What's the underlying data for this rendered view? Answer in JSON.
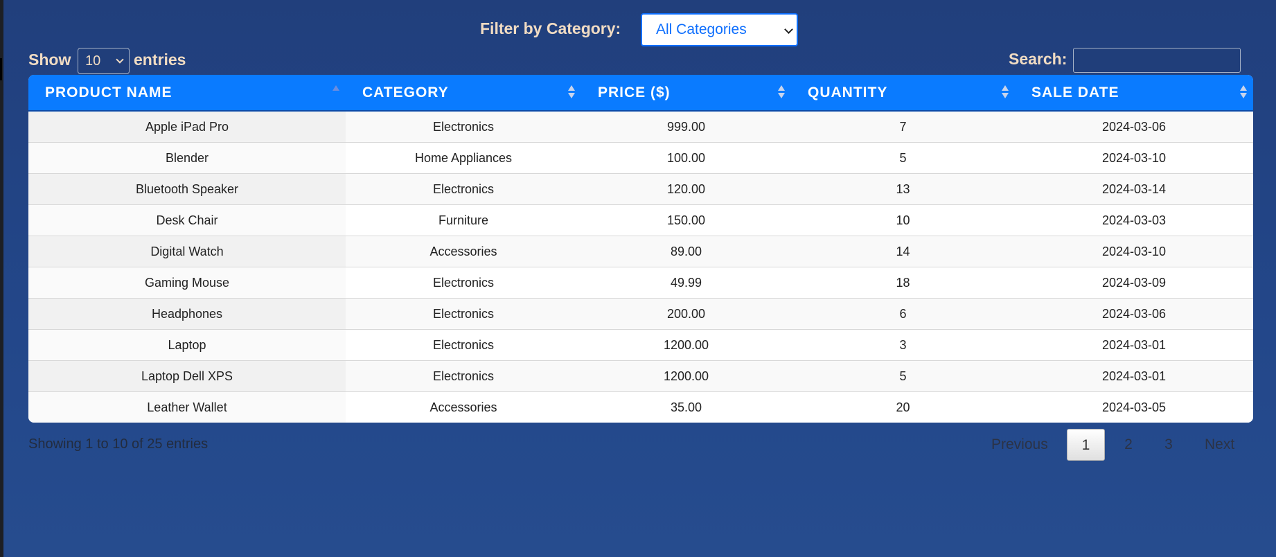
{
  "filter": {
    "label": "Filter by Category:",
    "selected": "All Categories"
  },
  "length": {
    "show_label": "Show",
    "selected": "10",
    "entries_label": "entries"
  },
  "search": {
    "label": "Search:",
    "value": "",
    "placeholder": ""
  },
  "table": {
    "headers": [
      "PRODUCT NAME",
      "CATEGORY",
      "PRICE ($)",
      "QUANTITY",
      "SALE DATE"
    ],
    "sorted_column": "PRODUCT NAME",
    "sort_direction": "ascending",
    "rows": [
      [
        "Apple iPad Pro",
        "Electronics",
        "999.00",
        "7",
        "2024-03-06"
      ],
      [
        "Blender",
        "Home Appliances",
        "100.00",
        "5",
        "2024-03-10"
      ],
      [
        "Bluetooth Speaker",
        "Electronics",
        "120.00",
        "13",
        "2024-03-14"
      ],
      [
        "Desk Chair",
        "Furniture",
        "150.00",
        "10",
        "2024-03-03"
      ],
      [
        "Digital Watch",
        "Accessories",
        "89.00",
        "14",
        "2024-03-10"
      ],
      [
        "Gaming Mouse",
        "Electronics",
        "49.99",
        "18",
        "2024-03-09"
      ],
      [
        "Headphones",
        "Electronics",
        "200.00",
        "6",
        "2024-03-06"
      ],
      [
        "Laptop",
        "Electronics",
        "1200.00",
        "3",
        "2024-03-01"
      ],
      [
        "Laptop Dell XPS",
        "Electronics",
        "1200.00",
        "5",
        "2024-03-01"
      ],
      [
        "Leather Wallet",
        "Accessories",
        "35.00",
        "20",
        "2024-03-05"
      ]
    ]
  },
  "info": "Showing 1 to 10 of 25 entries",
  "pagination": {
    "previous": "Previous",
    "pages": [
      "1",
      "2",
      "3"
    ],
    "current": "1",
    "next": "Next"
  },
  "colors": {
    "header_bg": "#0a7bff",
    "page_bg": "#23478a",
    "label_text": "#f1dcc3",
    "accent": "#0d6efd"
  }
}
